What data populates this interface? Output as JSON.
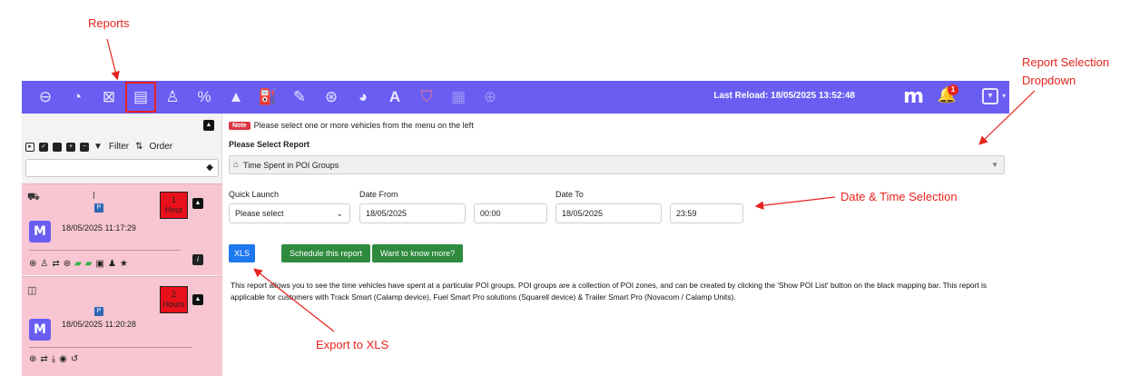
{
  "annotations": {
    "reports": "Reports",
    "report_selection": "Report Selection",
    "report_selection_2": "Dropdown",
    "date_time_selection": "Date & Time Selection",
    "export_xls": "Export to XLS"
  },
  "topbar": {
    "icons": [
      "back-arrow-icon",
      "dashboard-gauge-icon",
      "map-pin-icon",
      "reports-document-icon",
      "poi-person-pin-icon",
      "percent-tools-icon",
      "warning-icon",
      "fuel-pump-icon",
      "edit-icon",
      "lifebuoy-icon",
      "speedometer-icon",
      "font-a-icon",
      "shield-icon",
      "truck-icon",
      "steering-wheel-icon"
    ],
    "last_reload": "Last Reload: 18/05/2025 13:52:48",
    "bell_count": "1",
    "accent": "#6a5df2"
  },
  "sidebar": {
    "filter_label": "Filter",
    "order_label": "Order",
    "vehicles": [
      {
        "hours_top": "1",
        "hours_bottom": "Hour",
        "p": "P",
        "date": "18/05/2025 11:17:29",
        "logo": "M"
      },
      {
        "hours_top": "2",
        "hours_bottom": "Hours",
        "p": "P",
        "date": "18/05/2025 11:20:28",
        "logo": "M"
      }
    ]
  },
  "main": {
    "note_badge": "Note",
    "note_text": "Please select one or more vehicles from the menu on the left",
    "select_label": "Please Select Report",
    "report_value": "Time Spent in POI Groups",
    "quick_launch_label": "Quick Launch",
    "quick_launch_value": "Please select",
    "date_from_label": "Date From",
    "date_from_value": "18/05/2025",
    "time_from_value": "00:00",
    "date_to_label": "Date To",
    "date_to_value": "18/05/2025",
    "time_to_value": "23:59",
    "xls_label": "XLS",
    "schedule_label": "Schedule this report",
    "more_label": "Want to know more?",
    "description": "This report allows you to see the time vehicles have spent at a particular POI groups. POI groups are a collection of POI zones, and can be created by clicking the 'Show POI List' button on the black mapping bar. This report is applicable for customers with Track Smart (Calamp device), Fuel Smart Pro solutions (Squarell device) & Trailer Smart Pro (Novacom / Calamp Units)."
  }
}
